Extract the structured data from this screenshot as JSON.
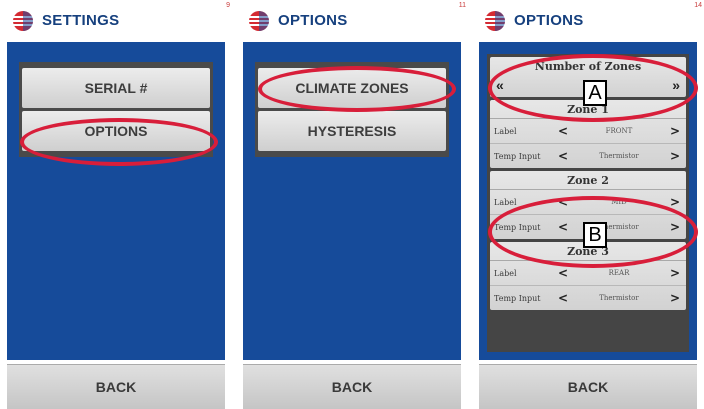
{
  "panels": [
    {
      "title": "SETTINGS",
      "page_number": "9",
      "buttons": [
        "SERIAL #",
        "OPTIONS"
      ],
      "back_label": "BACK"
    },
    {
      "title": "OPTIONS",
      "page_number": "11",
      "buttons": [
        "CLIMATE ZONES",
        "HYSTERESIS"
      ],
      "back_label": "BACK"
    },
    {
      "title": "OPTIONS",
      "page_number": "14",
      "number_of_zones_label": "Number of Zones",
      "prev_symbol": "«",
      "next_symbol": "»",
      "zones": [
        {
          "name": "Zone 1",
          "label_field": "Label",
          "label_value": "FRONT",
          "input_field": "Temp Input",
          "input_value": "Thermistor"
        },
        {
          "name": "Zone 2",
          "label_field": "Label",
          "label_value": "MID",
          "input_field": "Temp Input",
          "input_value": "Thermistor"
        },
        {
          "name": "Zone 3",
          "label_field": "Label",
          "label_value": "REAR",
          "input_field": "Temp Input",
          "input_value": "Thermistor"
        }
      ],
      "back_label": "BACK"
    }
  ],
  "callouts": [
    "A",
    "B"
  ],
  "colors": {
    "header_text": "#16407e",
    "screen_bg": "#164b9a",
    "highlight": "#d81e3a"
  },
  "icons": {
    "logo": "striped-globe-logo",
    "left": "chevron-left-icon",
    "right": "chevron-right-icon"
  }
}
